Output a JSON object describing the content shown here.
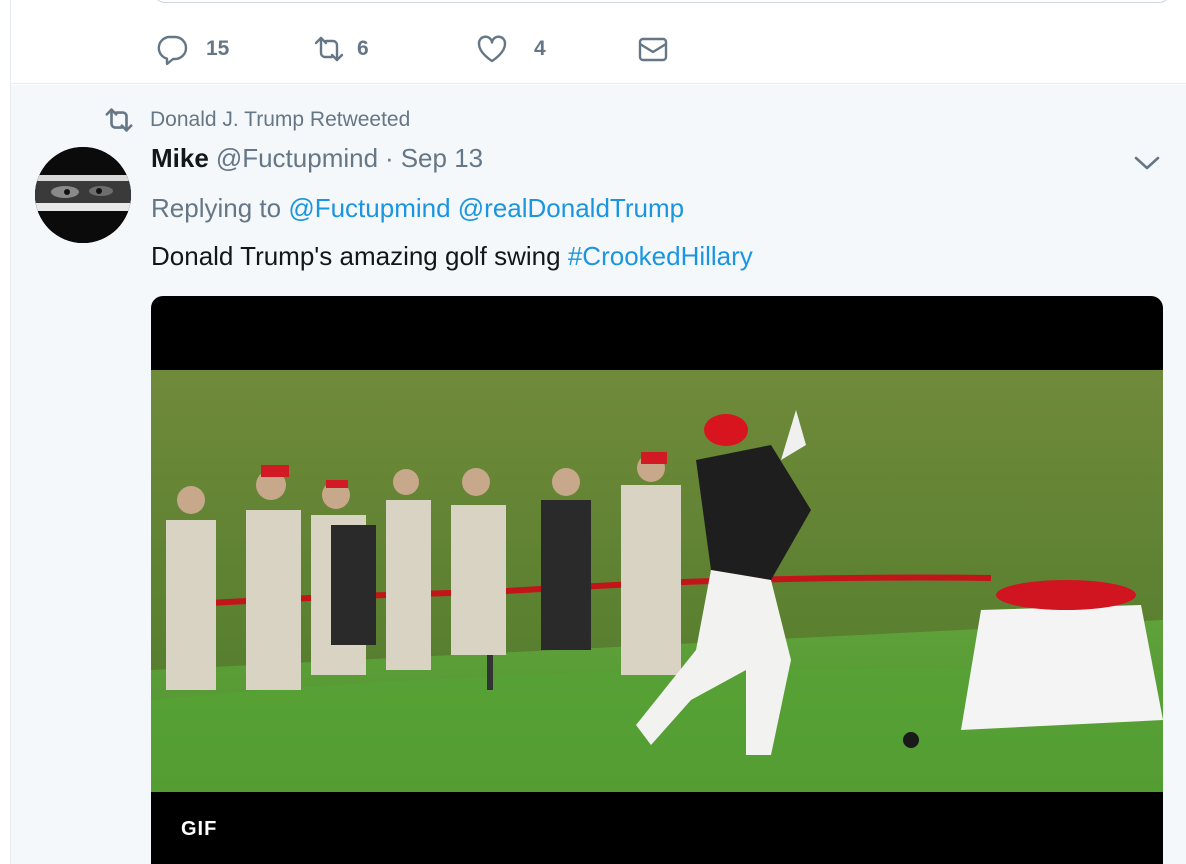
{
  "previous_tweet": {
    "actions": {
      "reply_count": "15",
      "retweet_count": "6",
      "like_count": "4"
    }
  },
  "tweet": {
    "retweet_context": "Donald J. Trump Retweeted",
    "author": {
      "fullname": "Mike",
      "handle": "@Fuctupmind"
    },
    "separator": "·",
    "timestamp": "Sep 13",
    "replying_to": {
      "prefix": "Replying to",
      "mentions": [
        "@Fuctupmind",
        "@realDonaldTrump"
      ]
    },
    "text": {
      "body": "Donald Trump's amazing golf swing",
      "hashtag": "#CrookedHillary"
    },
    "media": {
      "badge": "GIF"
    }
  },
  "icons": [
    "reply-icon",
    "retweet-icon",
    "like-icon",
    "direct-message-icon",
    "chevron-down-icon"
  ],
  "colors": {
    "link": "#1b95e0",
    "secondary_text": "#657786",
    "tweet_bg": "#f5f8fa"
  }
}
